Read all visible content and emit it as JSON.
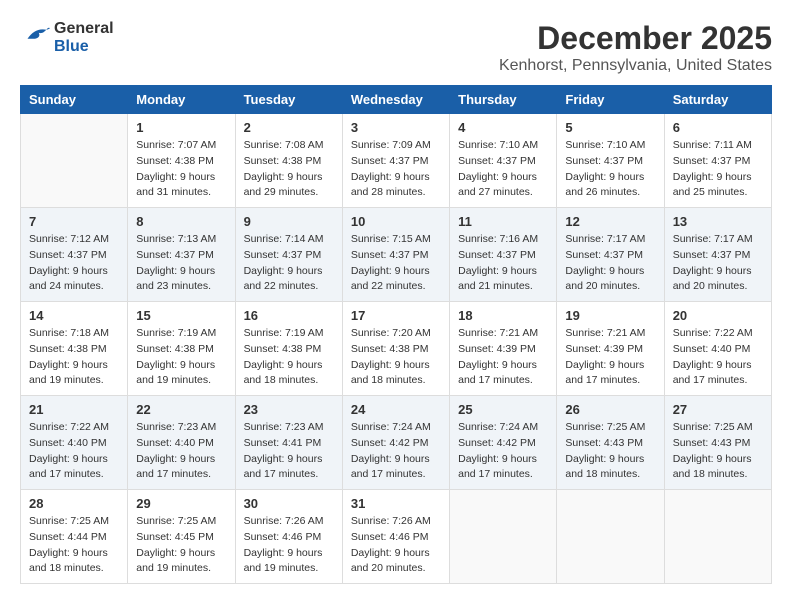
{
  "logo": {
    "general": "General",
    "blue": "Blue"
  },
  "title": "December 2025",
  "location": "Kenhorst, Pennsylvania, United States",
  "days_of_week": [
    "Sunday",
    "Monday",
    "Tuesday",
    "Wednesday",
    "Thursday",
    "Friday",
    "Saturday"
  ],
  "weeks": [
    {
      "shaded": false,
      "days": [
        {
          "day": "",
          "sunrise": "",
          "sunset": "",
          "daylight": "",
          "empty": true
        },
        {
          "day": "1",
          "sunrise": "Sunrise: 7:07 AM",
          "sunset": "Sunset: 4:38 PM",
          "daylight": "Daylight: 9 hours and 31 minutes."
        },
        {
          "day": "2",
          "sunrise": "Sunrise: 7:08 AM",
          "sunset": "Sunset: 4:38 PM",
          "daylight": "Daylight: 9 hours and 29 minutes."
        },
        {
          "day": "3",
          "sunrise": "Sunrise: 7:09 AM",
          "sunset": "Sunset: 4:37 PM",
          "daylight": "Daylight: 9 hours and 28 minutes."
        },
        {
          "day": "4",
          "sunrise": "Sunrise: 7:10 AM",
          "sunset": "Sunset: 4:37 PM",
          "daylight": "Daylight: 9 hours and 27 minutes."
        },
        {
          "day": "5",
          "sunrise": "Sunrise: 7:10 AM",
          "sunset": "Sunset: 4:37 PM",
          "daylight": "Daylight: 9 hours and 26 minutes."
        },
        {
          "day": "6",
          "sunrise": "Sunrise: 7:11 AM",
          "sunset": "Sunset: 4:37 PM",
          "daylight": "Daylight: 9 hours and 25 minutes."
        }
      ]
    },
    {
      "shaded": true,
      "days": [
        {
          "day": "7",
          "sunrise": "Sunrise: 7:12 AM",
          "sunset": "Sunset: 4:37 PM",
          "daylight": "Daylight: 9 hours and 24 minutes."
        },
        {
          "day": "8",
          "sunrise": "Sunrise: 7:13 AM",
          "sunset": "Sunset: 4:37 PM",
          "daylight": "Daylight: 9 hours and 23 minutes."
        },
        {
          "day": "9",
          "sunrise": "Sunrise: 7:14 AM",
          "sunset": "Sunset: 4:37 PM",
          "daylight": "Daylight: 9 hours and 22 minutes."
        },
        {
          "day": "10",
          "sunrise": "Sunrise: 7:15 AM",
          "sunset": "Sunset: 4:37 PM",
          "daylight": "Daylight: 9 hours and 22 minutes."
        },
        {
          "day": "11",
          "sunrise": "Sunrise: 7:16 AM",
          "sunset": "Sunset: 4:37 PM",
          "daylight": "Daylight: 9 hours and 21 minutes."
        },
        {
          "day": "12",
          "sunrise": "Sunrise: 7:17 AM",
          "sunset": "Sunset: 4:37 PM",
          "daylight": "Daylight: 9 hours and 20 minutes."
        },
        {
          "day": "13",
          "sunrise": "Sunrise: 7:17 AM",
          "sunset": "Sunset: 4:37 PM",
          "daylight": "Daylight: 9 hours and 20 minutes."
        }
      ]
    },
    {
      "shaded": false,
      "days": [
        {
          "day": "14",
          "sunrise": "Sunrise: 7:18 AM",
          "sunset": "Sunset: 4:38 PM",
          "daylight": "Daylight: 9 hours and 19 minutes."
        },
        {
          "day": "15",
          "sunrise": "Sunrise: 7:19 AM",
          "sunset": "Sunset: 4:38 PM",
          "daylight": "Daylight: 9 hours and 19 minutes."
        },
        {
          "day": "16",
          "sunrise": "Sunrise: 7:19 AM",
          "sunset": "Sunset: 4:38 PM",
          "daylight": "Daylight: 9 hours and 18 minutes."
        },
        {
          "day": "17",
          "sunrise": "Sunrise: 7:20 AM",
          "sunset": "Sunset: 4:38 PM",
          "daylight": "Daylight: 9 hours and 18 minutes."
        },
        {
          "day": "18",
          "sunrise": "Sunrise: 7:21 AM",
          "sunset": "Sunset: 4:39 PM",
          "daylight": "Daylight: 9 hours and 17 minutes."
        },
        {
          "day": "19",
          "sunrise": "Sunrise: 7:21 AM",
          "sunset": "Sunset: 4:39 PM",
          "daylight": "Daylight: 9 hours and 17 minutes."
        },
        {
          "day": "20",
          "sunrise": "Sunrise: 7:22 AM",
          "sunset": "Sunset: 4:40 PM",
          "daylight": "Daylight: 9 hours and 17 minutes."
        }
      ]
    },
    {
      "shaded": true,
      "days": [
        {
          "day": "21",
          "sunrise": "Sunrise: 7:22 AM",
          "sunset": "Sunset: 4:40 PM",
          "daylight": "Daylight: 9 hours and 17 minutes."
        },
        {
          "day": "22",
          "sunrise": "Sunrise: 7:23 AM",
          "sunset": "Sunset: 4:40 PM",
          "daylight": "Daylight: 9 hours and 17 minutes."
        },
        {
          "day": "23",
          "sunrise": "Sunrise: 7:23 AM",
          "sunset": "Sunset: 4:41 PM",
          "daylight": "Daylight: 9 hours and 17 minutes."
        },
        {
          "day": "24",
          "sunrise": "Sunrise: 7:24 AM",
          "sunset": "Sunset: 4:42 PM",
          "daylight": "Daylight: 9 hours and 17 minutes."
        },
        {
          "day": "25",
          "sunrise": "Sunrise: 7:24 AM",
          "sunset": "Sunset: 4:42 PM",
          "daylight": "Daylight: 9 hours and 17 minutes."
        },
        {
          "day": "26",
          "sunrise": "Sunrise: 7:25 AM",
          "sunset": "Sunset: 4:43 PM",
          "daylight": "Daylight: 9 hours and 18 minutes."
        },
        {
          "day": "27",
          "sunrise": "Sunrise: 7:25 AM",
          "sunset": "Sunset: 4:43 PM",
          "daylight": "Daylight: 9 hours and 18 minutes."
        }
      ]
    },
    {
      "shaded": false,
      "days": [
        {
          "day": "28",
          "sunrise": "Sunrise: 7:25 AM",
          "sunset": "Sunset: 4:44 PM",
          "daylight": "Daylight: 9 hours and 18 minutes."
        },
        {
          "day": "29",
          "sunrise": "Sunrise: 7:25 AM",
          "sunset": "Sunset: 4:45 PM",
          "daylight": "Daylight: 9 hours and 19 minutes."
        },
        {
          "day": "30",
          "sunrise": "Sunrise: 7:26 AM",
          "sunset": "Sunset: 4:46 PM",
          "daylight": "Daylight: 9 hours and 19 minutes."
        },
        {
          "day": "31",
          "sunrise": "Sunrise: 7:26 AM",
          "sunset": "Sunset: 4:46 PM",
          "daylight": "Daylight: 9 hours and 20 minutes."
        },
        {
          "day": "",
          "sunrise": "",
          "sunset": "",
          "daylight": "",
          "empty": true
        },
        {
          "day": "",
          "sunrise": "",
          "sunset": "",
          "daylight": "",
          "empty": true
        },
        {
          "day": "",
          "sunrise": "",
          "sunset": "",
          "daylight": "",
          "empty": true
        }
      ]
    }
  ]
}
